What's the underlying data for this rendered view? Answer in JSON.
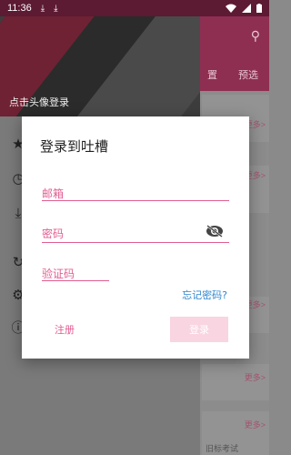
{
  "status_bar": {
    "time": "11:36",
    "icons": [
      "download-icon",
      "download-icon",
      "wifi-icon",
      "signal-icon",
      "battery-icon"
    ]
  },
  "app": {
    "tabs": [
      "置",
      "预选"
    ],
    "more_label": "更多>",
    "partial_text": "旧标考试",
    "accent": "#e05d90",
    "brand_color": "#8e2f52"
  },
  "drawer": {
    "login_hint": "点击头像登录",
    "items": [
      {
        "icon": "star-icon"
      },
      {
        "icon": "history-icon"
      },
      {
        "icon": "download-icon"
      },
      {
        "icon": "refresh-icon"
      },
      {
        "icon": "settings-icon"
      },
      {
        "icon": "info-icon"
      }
    ]
  },
  "dialog": {
    "title": "登录到吐槽",
    "email_label": "邮箱",
    "password_label": "密码",
    "captcha_label": "验证码",
    "forgot_label": "忘记密码?",
    "register_label": "注册",
    "login_label": "登录"
  }
}
